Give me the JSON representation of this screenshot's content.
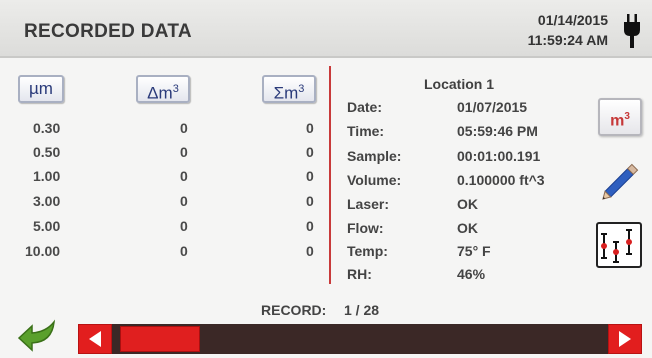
{
  "header": {
    "title": "RECORDED DATA",
    "date": "01/14/2015",
    "time": "11:59:24 AM"
  },
  "columns": {
    "size_label": "µm",
    "delta_label": "Δm",
    "delta_sup": "3",
    "sum_label": "Σm",
    "sum_sup": "3"
  },
  "rows": [
    {
      "size": "0.30",
      "delta": "0",
      "sum": "0"
    },
    {
      "size": "0.50",
      "delta": "0",
      "sum": "0"
    },
    {
      "size": "1.00",
      "delta": "0",
      "sum": "0"
    },
    {
      "size": "3.00",
      "delta": "0",
      "sum": "0"
    },
    {
      "size": "5.00",
      "delta": "0",
      "sum": "0"
    },
    {
      "size": "10.00",
      "delta": "0",
      "sum": "0"
    }
  ],
  "info": {
    "location": "Location 1",
    "fields": [
      {
        "label": "Date:",
        "value": "01/07/2015"
      },
      {
        "label": "Time:",
        "value": "05:59:46 PM"
      },
      {
        "label": "Sample:",
        "value": "00:01:00.191"
      },
      {
        "label": "Volume:",
        "value": "0.100000 ft^3"
      },
      {
        "label": "Laser:",
        "value": "OK"
      },
      {
        "label": "Flow:",
        "value": "OK"
      },
      {
        "label": "Temp:",
        "value": "75° F"
      },
      {
        "label": "RH:",
        "value": "46%"
      }
    ]
  },
  "units_button": {
    "label": "m",
    "sup": "3"
  },
  "record": {
    "label": "RECORD:",
    "value": "1 / 28",
    "current": 1,
    "total": 28
  },
  "icons": {
    "plug": "plug-icon",
    "pencil": "pencil-icon",
    "chart": "chart-icon",
    "back": "back-arrow-icon",
    "left": "arrow-left-icon",
    "right": "arrow-right-icon"
  },
  "colors": {
    "accent_red": "#e21e1e",
    "divider_red": "#c83a3a",
    "button_blue": "#2a3a7a",
    "scrollbar_dark": "#3b2826",
    "back_green": "#5aa02c"
  }
}
